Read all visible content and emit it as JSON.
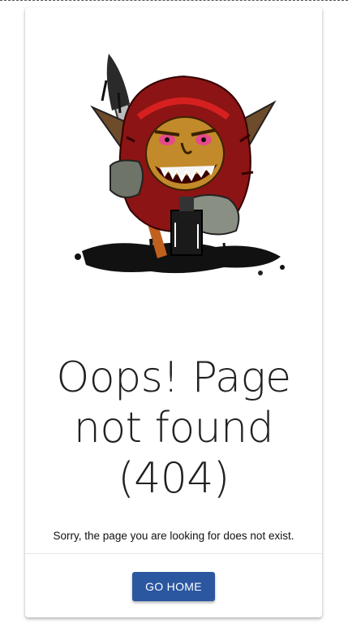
{
  "page": {
    "title": "Oops! Page not found (404)",
    "message": "Sorry, the page you are looking for does not exist.",
    "home_button_label": "GO HOME"
  },
  "illustration": {
    "icon": "goblin-with-paintbrush-icon"
  },
  "colors": {
    "button_bg": "#2b56a0",
    "button_text": "#ffffff",
    "title_text": "#212121"
  }
}
